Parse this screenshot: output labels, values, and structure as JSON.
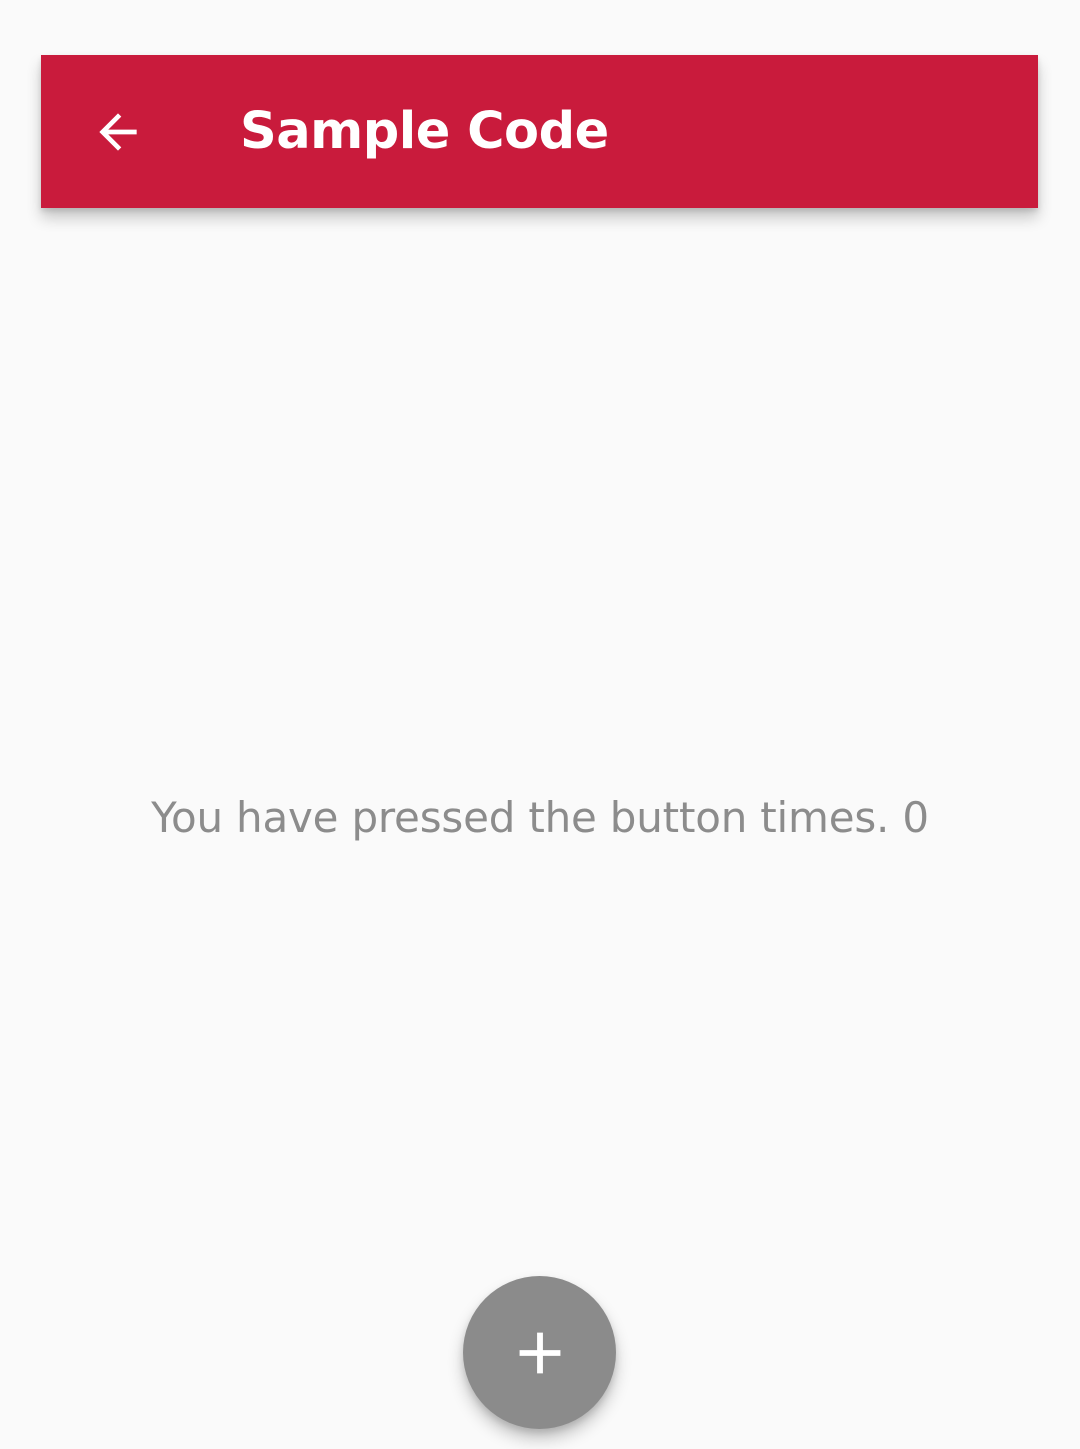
{
  "app_bar": {
    "title": "Sample Code",
    "background_color": "#c91b3c",
    "back_icon": "arrow-back-icon"
  },
  "main": {
    "counter_text": "You have pressed the button times. 0"
  },
  "fab": {
    "icon": "plus-icon",
    "background_color": "#8b8b8b"
  }
}
